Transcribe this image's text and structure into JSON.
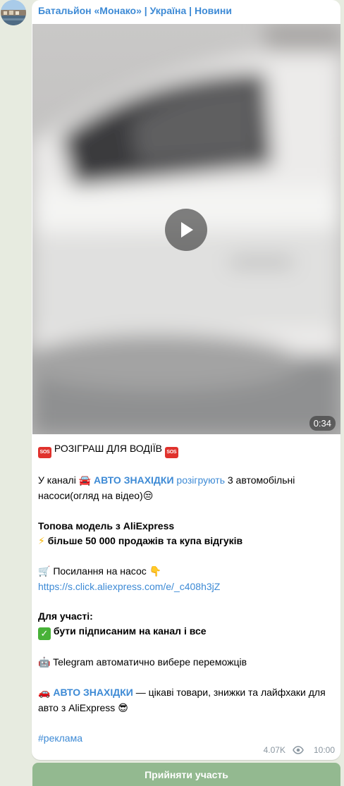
{
  "channel": {
    "name": "Батальйон «Монако» | Україна | Новини"
  },
  "video": {
    "duration": "0:34"
  },
  "post": {
    "headline": "РОЗІГРАШ ДЛЯ ВОДІЇВ",
    "intro_prefix": "У каналі ",
    "intro_channel_link": "АВТО ЗНАХІДКИ",
    "intro_giveaway_link": "розігрують",
    "intro_suffix": " 3 автомобільні насоси(огляд на відео)",
    "top_model": "Топова модель з AliExpress",
    "sales": "більше 50 000 продажів та купа відгуків",
    "pump_link_label": "Посилання на насос",
    "pump_url": "https://s.click.aliexpress.com/e/_c408h3jZ",
    "participation_title": "Для участі:",
    "participation_rule": "бути підписаним на канал і все",
    "bot_text": "Telegram автоматично вибере переможців",
    "footer_channel_link": "АВТО ЗНАХІДКИ",
    "footer_text": " — цікаві товари, знижки та лайфхаки для авто з AliExpress",
    "hashtag": "#реклама"
  },
  "meta": {
    "views": "4.07K",
    "time": "10:00"
  },
  "join_button": {
    "label": "Прийняти участь"
  },
  "colors": {
    "accent": "#3d8ad5",
    "chat_background": "#e7ebe0",
    "button": "#93b990"
  },
  "icons": [
    "channel-avatar",
    "play-icon",
    "sos-icon",
    "car-icon",
    "unamused-face-icon",
    "lightning-icon",
    "cart-icon",
    "pointing-down-icon",
    "check-mark-icon",
    "robot-icon",
    "red-car-icon",
    "sunglasses-face-icon",
    "eye-icon"
  ]
}
